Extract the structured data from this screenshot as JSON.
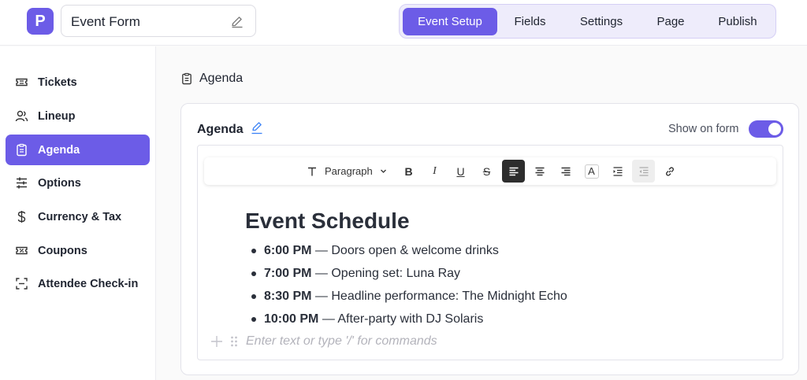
{
  "app": {
    "logo_letter": "P",
    "form_title": "Event Form"
  },
  "tabs": [
    {
      "label": "Event Setup",
      "active": true
    },
    {
      "label": "Fields"
    },
    {
      "label": "Settings"
    },
    {
      "label": "Page"
    },
    {
      "label": "Publish"
    }
  ],
  "sidebar": {
    "items": [
      {
        "label": "Tickets",
        "icon": "ticket-icon"
      },
      {
        "label": "Lineup",
        "icon": "users-icon"
      },
      {
        "label": "Agenda",
        "icon": "clipboard-icon",
        "active": true
      },
      {
        "label": "Options",
        "icon": "sliders-icon"
      },
      {
        "label": "Currency & Tax",
        "icon": "dollar-icon"
      },
      {
        "label": "Coupons",
        "icon": "coupon-icon"
      },
      {
        "label": "Attendee Check-in",
        "icon": "scan-icon"
      }
    ]
  },
  "main": {
    "section_title": "Agenda",
    "card": {
      "label": "Agenda",
      "show_on_form_label": "Show on form",
      "show_on_form": true
    },
    "toolbar": {
      "paragraph_label": "Paragraph",
      "buttons": [
        "text-type-icon",
        "bold-icon",
        "italic-icon",
        "underline-icon",
        "strikethrough-icon",
        "align-left-icon",
        "align-center-icon",
        "align-right-icon",
        "text-color-icon",
        "indent-icon",
        "outdent-icon",
        "link-icon"
      ]
    },
    "document": {
      "heading": "Event Schedule",
      "items": [
        {
          "time": "6:00 PM",
          "text": " — Doors open & welcome drinks"
        },
        {
          "time": "7:00 PM",
          "text": " — Opening set: Luna Ray"
        },
        {
          "time": "8:30 PM",
          "text": " — Headline performance: The Midnight Echo"
        },
        {
          "time": "10:00 PM",
          "text": " — After-party with DJ Solaris"
        }
      ],
      "placeholder": "Enter text or type '/' for commands"
    }
  },
  "colors": {
    "accent": "#6c5ce7",
    "accent_light": "#eeecfb"
  }
}
